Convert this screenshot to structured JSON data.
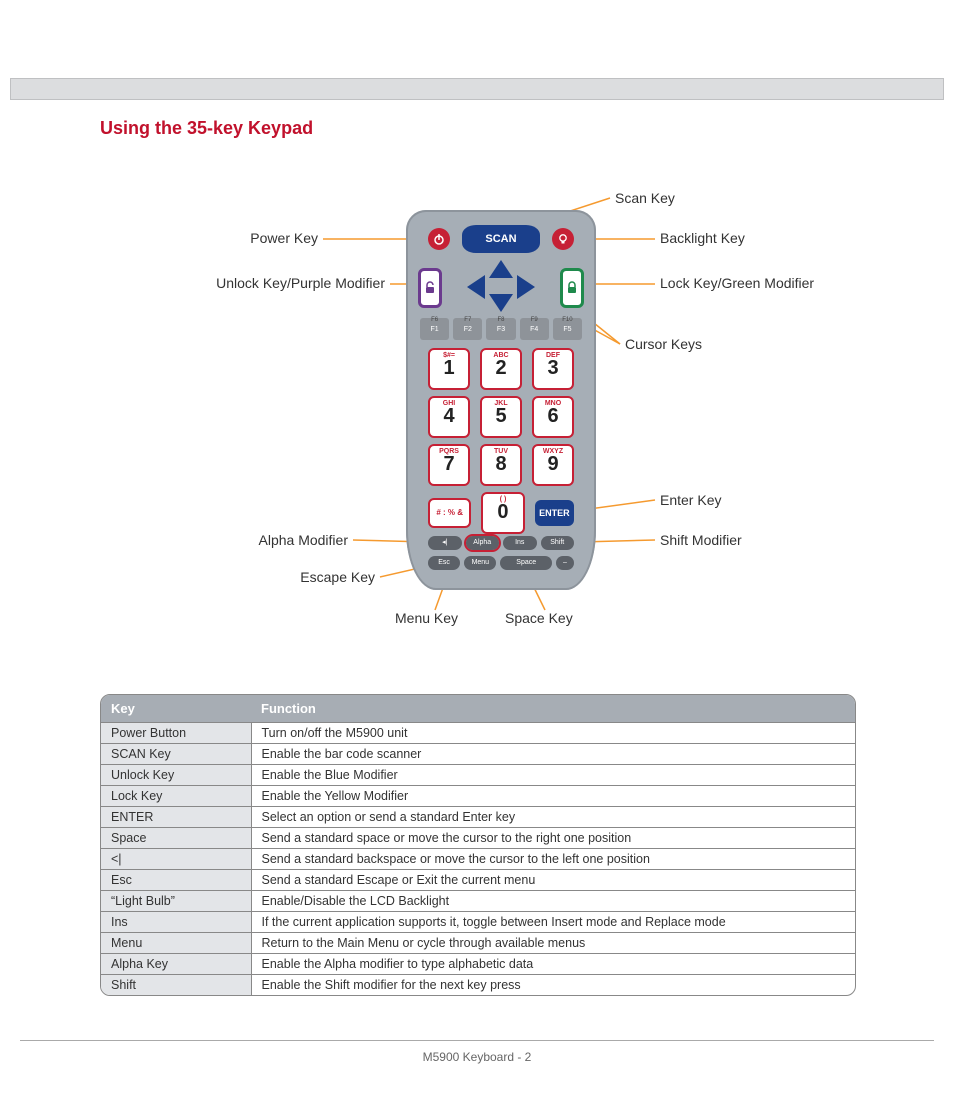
{
  "heading": "Using the 35-key Keypad",
  "keypad": {
    "scan": "SCAN",
    "fkeys": [
      {
        "top": "F6",
        "main": "F1"
      },
      {
        "top": "F7",
        "main": "F2"
      },
      {
        "top": "F8",
        "main": "F3"
      },
      {
        "top": "F9",
        "main": "F4"
      },
      {
        "top": "F10",
        "main": "F5"
      }
    ],
    "nums": [
      [
        {
          "top": "$#=",
          "n": "1"
        },
        {
          "top": "ABC",
          "n": "2"
        },
        {
          "top": "DEF",
          "n": "3"
        }
      ],
      [
        {
          "top": "GHI",
          "n": "4"
        },
        {
          "top": "JKL",
          "n": "5"
        },
        {
          "top": "MNO",
          "n": "6"
        }
      ],
      [
        {
          "top": "PQRS",
          "n": "7"
        },
        {
          "top": "TUV",
          "n": "8"
        },
        {
          "top": "WXYZ",
          "n": "9"
        }
      ]
    ],
    "hash": "# : % &",
    "zero": {
      "top": "( )",
      "n": "0"
    },
    "enter": "ENTER",
    "modrow": [
      "◂|",
      "Alpha",
      "Ins",
      "Shift"
    ],
    "lastrow": [
      "Esc",
      "Menu",
      "Space",
      "–"
    ]
  },
  "callouts": {
    "left": {
      "power": "Power Key",
      "unlock": "Unlock Key/Purple Modifier",
      "alpha": "Alpha Modifier",
      "escape": "Escape Key",
      "menu": "Menu Key"
    },
    "right": {
      "scan": "Scan Key",
      "backlight": "Backlight Key",
      "lock": "Lock Key/Green Modifier",
      "cursor": "Cursor Keys",
      "enter": "Enter Key",
      "shift": "Shift Modifier"
    },
    "bottom": {
      "space": "Space Key"
    }
  },
  "table": {
    "headers": [
      "Key",
      "Function"
    ],
    "rows": [
      [
        "Power Button",
        "Turn on/off the M5900 unit"
      ],
      [
        "SCAN Key",
        "Enable the bar code scanner"
      ],
      [
        "Unlock Key",
        "Enable the Blue Modifier"
      ],
      [
        "Lock Key",
        "Enable the Yellow Modifier"
      ],
      [
        "ENTER",
        "Select an option or send a standard Enter key"
      ],
      [
        "Space",
        "Send a standard space or move the cursor to the right one position"
      ],
      [
        "<|",
        "Send a standard backspace or move the cursor to the left one position"
      ],
      [
        "Esc",
        "Send a standard Escape or Exit the current menu"
      ],
      [
        "“Light Bulb”",
        "Enable/Disable the LCD Backlight"
      ],
      [
        "Ins",
        "If the current application supports it, toggle between Insert mode and Replace mode"
      ],
      [
        "Menu",
        "Return to the Main Menu or cycle through available menus"
      ],
      [
        "Alpha Key",
        "Enable the Alpha modifier to type alphabetic data"
      ],
      [
        "Shift",
        "Enable the Shift modifier for the next key press"
      ]
    ]
  },
  "footer": "M5900 Keyboard - 2"
}
